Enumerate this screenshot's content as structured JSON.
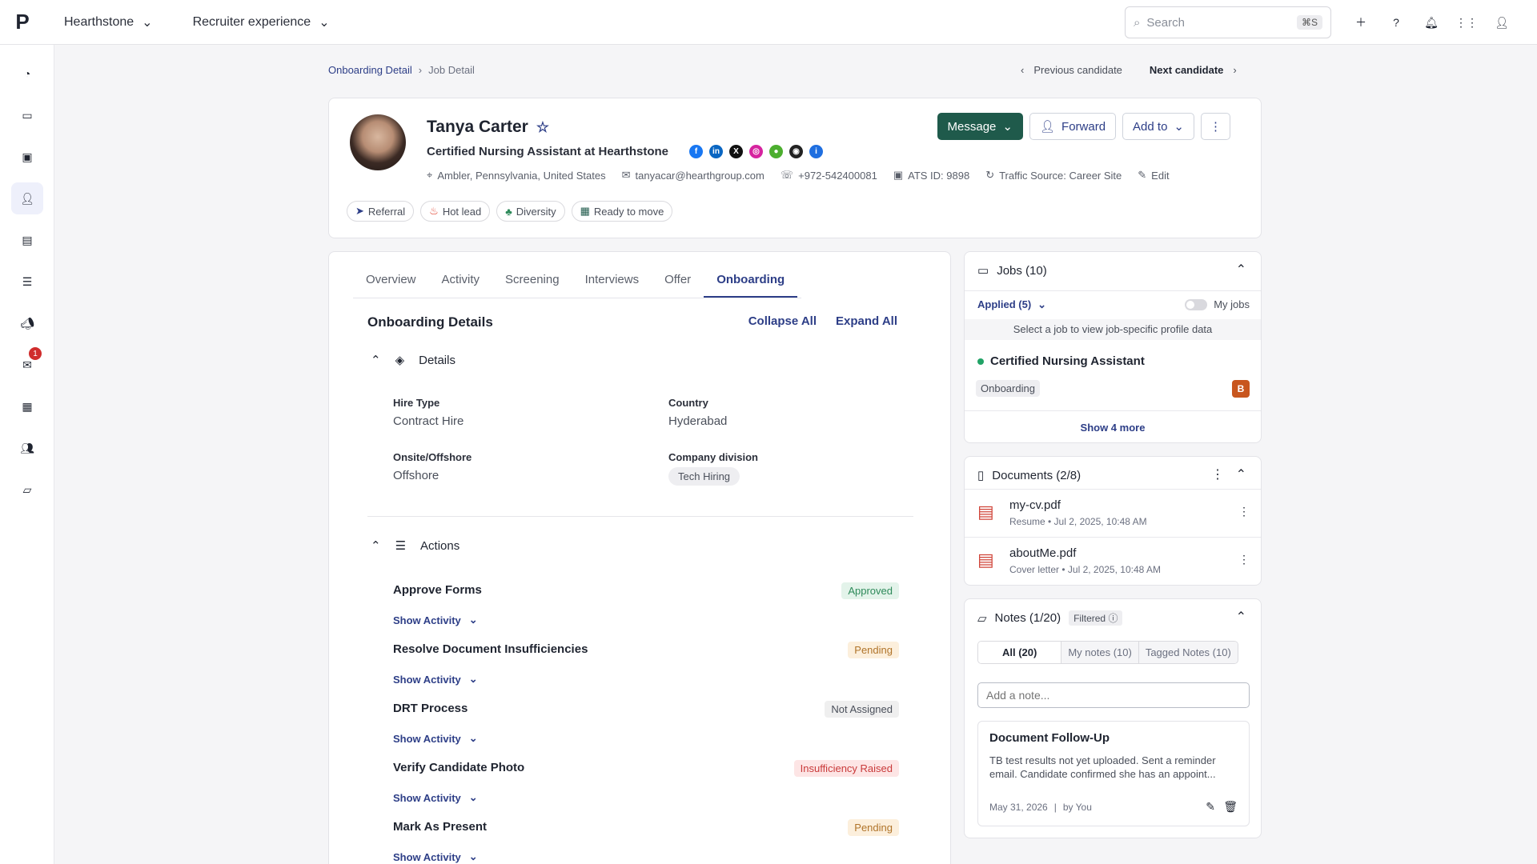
{
  "top": {
    "workspace": "Hearthstone",
    "experience": "Recruiter experience",
    "search_placeholder": "Search",
    "search_shortcut": "⌘S"
  },
  "sidebar": {
    "messages_badge": "1"
  },
  "breadcrumb": {
    "parent": "Onboarding Detail",
    "current": "Job Detail"
  },
  "candidate_nav": {
    "previous": "Previous candidate",
    "next": "Next candidate"
  },
  "candidate": {
    "name": "Tanya Carter",
    "title": "Certified Nursing Assistant at Hearthstone",
    "location": "Ambler, Pennsylvania, United States",
    "email": "tanyacar@hearthgroup.com",
    "phone": "+972-542400081",
    "ats_id": "ATS ID: 9898",
    "traffic_source": "Traffic Source: Career Site",
    "edit_label": "Edit",
    "tags": [
      "Referral",
      "Hot lead",
      "Diversity",
      "Ready to move"
    ]
  },
  "header_actions": {
    "message": "Message",
    "forward": "Forward",
    "add_to": "Add to"
  },
  "tabs": [
    "Overview",
    "Activity",
    "Screening",
    "Interviews",
    "Offer",
    "Onboarding"
  ],
  "onboarding": {
    "title": "Onboarding Details",
    "collapse_all": "Collapse All",
    "expand_all": "Expand All",
    "details_label": "Details",
    "fields": {
      "hire_type_label": "Hire Type",
      "hire_type": "Contract Hire",
      "country_label": "Country",
      "country": "Hyderabad",
      "onsite_label": "Onsite/Offshore",
      "onsite": "Offshore",
      "division_label": "Company division",
      "division": "Tech Hiring"
    },
    "actions_label": "Actions",
    "show_activity": "Show Activity",
    "actions": [
      {
        "name": "Approve Forms",
        "status": "Approved"
      },
      {
        "name": "Resolve Document Insufficiencies",
        "status": "Pending"
      },
      {
        "name": "DRT Process",
        "status": "Not Assigned"
      },
      {
        "name": "Verify Candidate Photo",
        "status": "Insufficiency Raised"
      },
      {
        "name": "Mark As Present",
        "status": "Pending"
      }
    ]
  },
  "jobs": {
    "title": "Jobs (10)",
    "filter": "Applied (5)",
    "my_jobs": "My jobs",
    "hint": "Select a job to view job-specific profile data",
    "job_title": "Certified Nursing Assistant",
    "job_stage": "Onboarding",
    "job_badge": "B",
    "show_more": "Show 4 more"
  },
  "documents": {
    "title": "Documents (2/8)",
    "items": [
      {
        "name": "my-cv.pdf",
        "meta": "Resume • Jul 2, 2025, 10:48 AM"
      },
      {
        "name": "aboutMe.pdf",
        "meta": "Cover letter • Jul 2, 2025, 10:48 AM"
      }
    ]
  },
  "notes": {
    "title": "Notes (1/20)",
    "filtered": "Filtered",
    "tabs": [
      "All (20)",
      "My notes (10)",
      "Tagged Notes (10)"
    ],
    "placeholder": "Add a note...",
    "note_title": "Document Follow-Up",
    "note_body": "TB test results not yet uploaded. Sent a reminder email. Candidate confirmed she has an appoint...",
    "note_date": "May 31, 2026",
    "note_author": "by You"
  },
  "colors": {
    "primary": "#1f5a4b",
    "link": "#2d3e87",
    "accent_dot": "#21a366",
    "badge_orange": "#c8561e"
  }
}
